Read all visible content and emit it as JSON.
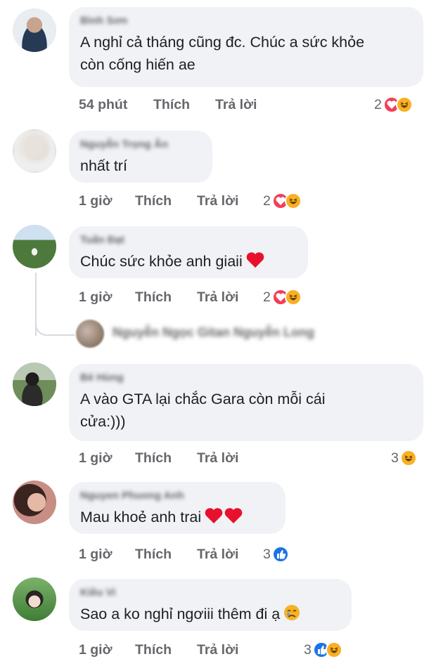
{
  "comments": [
    {
      "name": "Bình Sơn",
      "text": "A nghỉ cả tháng cũng đc. Chúc a sức khỏe\ncòn cống hiến ae",
      "time": "54 phút",
      "like": "Thích",
      "reply": "Trả lời",
      "reaction_count": "2",
      "reactions": [
        "heart",
        "haha"
      ]
    },
    {
      "name": "Nguyễn Trọng Ân",
      "text": "nhất trí",
      "time": "1 giờ",
      "like": "Thích",
      "reply": "Trả lời",
      "reaction_count": "2",
      "reactions": [
        "heart",
        "haha"
      ]
    },
    {
      "name": "Tuấn Đạt",
      "text": "Chúc sức khỏe anh giaii",
      "time": "1 giờ",
      "like": "Thích",
      "reply": "Trả lời",
      "reaction_count": "2",
      "reactions": [
        "heart",
        "haha"
      ],
      "reply_preview_name": "Nguyễn Ngọc Gitan Nguyễn Long"
    },
    {
      "name": "Bé Hùng",
      "text": "A vào GTA lại chắc Gara còn mỗi cái\ncửa:)))",
      "time": "1 giờ",
      "like": "Thích",
      "reply": "Trả lời",
      "reaction_count": "3",
      "reactions": [
        "haha"
      ]
    },
    {
      "name": "Nguyen Phuong Anh",
      "text": "Mau khoẻ anh trai",
      "time": "1 giờ",
      "like": "Thích",
      "reply": "Trả lời",
      "reaction_count": "3",
      "reactions": [
        "like"
      ]
    },
    {
      "name": "Kiều Vi",
      "text": "Sao a ko nghỉ ngơiii thêm đi ạ",
      "time": "1 giờ",
      "like": "Thích",
      "reply": "Trả lời",
      "reaction_count": "3",
      "reactions": [
        "like",
        "haha"
      ]
    }
  ],
  "colors": {
    "bubble": "#f0f2f5",
    "meta_text": "#65676b",
    "heart": "#f33e58",
    "haha": "#f7b125",
    "like": "#1b74e4"
  }
}
